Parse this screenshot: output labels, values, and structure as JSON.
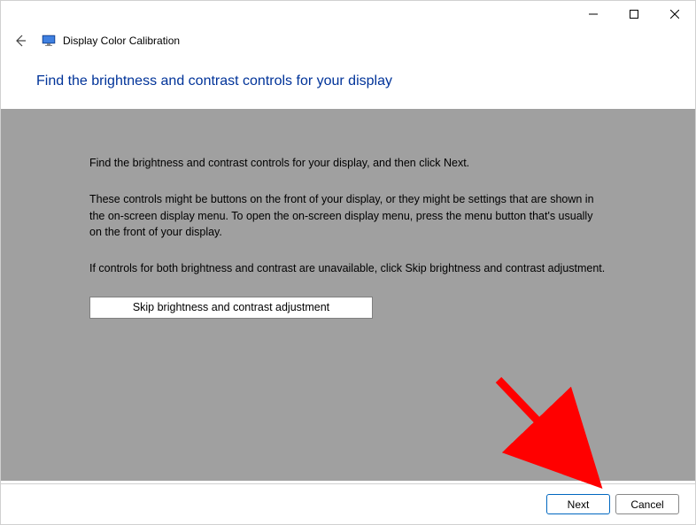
{
  "window": {
    "title": "Display Color Calibration"
  },
  "page": {
    "heading": "Find the brightness and contrast controls for your display"
  },
  "content": {
    "para1": "Find the brightness and contrast controls for your display, and then click Next.",
    "para2": "These controls might be buttons on the front of your display, or they might be settings that are shown in the on-screen display menu. To open the on-screen display menu, press the menu button that's usually on the front of your display.",
    "para3": "If controls for both brightness and contrast are unavailable, click Skip brightness and contrast adjustment."
  },
  "buttons": {
    "skip": "Skip brightness and contrast adjustment",
    "next": "Next",
    "cancel": "Cancel"
  }
}
